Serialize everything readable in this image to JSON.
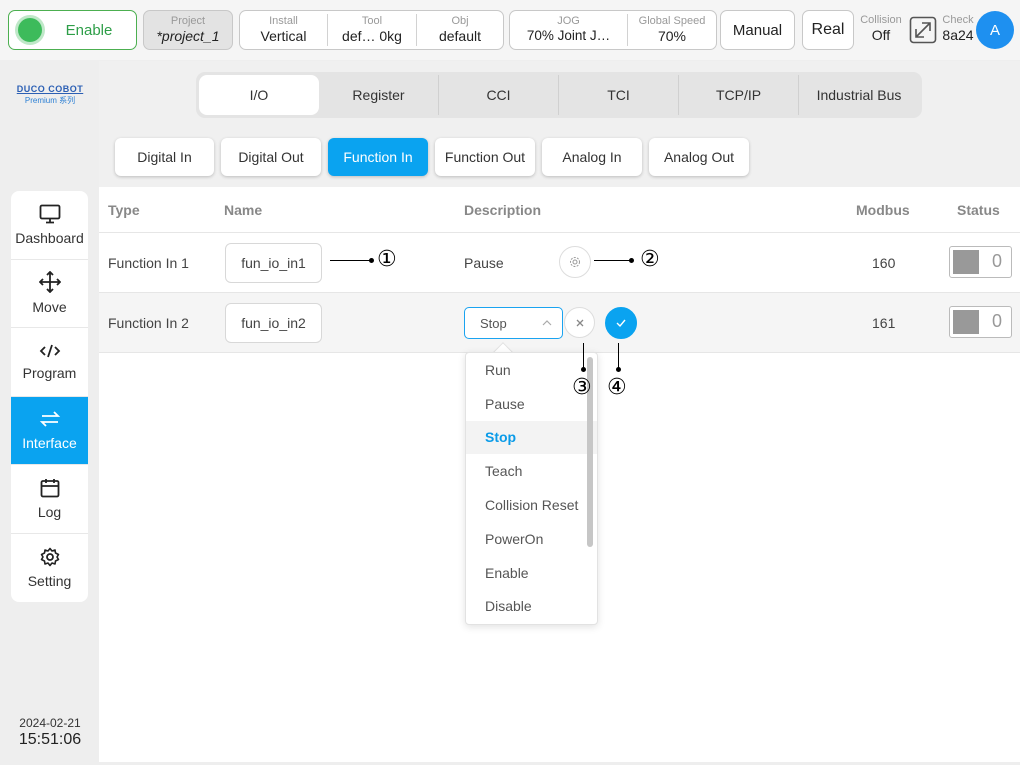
{
  "topbar": {
    "enable_label": "Enable",
    "project": {
      "label": "Project",
      "value": "*project_1"
    },
    "install": {
      "label": "Install",
      "value": "Vertical"
    },
    "tool": {
      "label": "Tool",
      "value": "def…  0kg"
    },
    "obj": {
      "label": "Obj",
      "value": "default"
    },
    "jog": {
      "label": "JOG",
      "value": "70%  Joint J…"
    },
    "global_speed": {
      "label": "Global Speed",
      "value": "70%"
    },
    "mode": "Manual",
    "real": "Real",
    "collision": {
      "label": "Collision",
      "value": "Off"
    },
    "check": {
      "label": "Check",
      "value": "8a24"
    },
    "avatar": "A"
  },
  "logo": {
    "main": "DUCO COBOT",
    "sub": "Premium 系列"
  },
  "sidebar": {
    "items": [
      {
        "label": "Dashboard",
        "icon": "monitor-icon"
      },
      {
        "label": "Move",
        "icon": "move-arrows-icon"
      },
      {
        "label": "Program",
        "icon": "code-icon"
      },
      {
        "label": "Interface",
        "icon": "swap-arrows-icon",
        "active": true
      },
      {
        "label": "Log",
        "icon": "calendar-icon"
      },
      {
        "label": "Setting",
        "icon": "gear-icon"
      }
    ],
    "date": "2024-02-21",
    "time": "15:51:06"
  },
  "tabs": [
    "I/O",
    "Register",
    "CCI",
    "TCI",
    "TCP/IP",
    "Industrial Bus"
  ],
  "subtabs": [
    "Digital In",
    "Digital Out",
    "Function In",
    "Function Out",
    "Analog In",
    "Analog Out"
  ],
  "table": {
    "headers": {
      "type": "Type",
      "name": "Name",
      "description": "Description",
      "modbus": "Modbus",
      "status": "Status"
    },
    "rows": [
      {
        "type": "Function In 1",
        "name": "fun_io_in1",
        "description": "Pause",
        "modbus": "160",
        "status": "0"
      },
      {
        "type": "Function In 2",
        "name": "fun_io_in2",
        "description": "Stop",
        "modbus": "161",
        "status": "0"
      }
    ]
  },
  "dropdown": {
    "options": [
      "Run",
      "Pause",
      "Stop",
      "Teach",
      "Collision Reset",
      "PowerOn",
      "Enable",
      "Disable"
    ],
    "selected": "Stop"
  },
  "callouts": [
    "①",
    "②",
    "③",
    "④"
  ],
  "colors": {
    "accent": "#0aa3f0",
    "enable_green": "#3dbb5b",
    "avatar_blue": "#1e90f0"
  }
}
